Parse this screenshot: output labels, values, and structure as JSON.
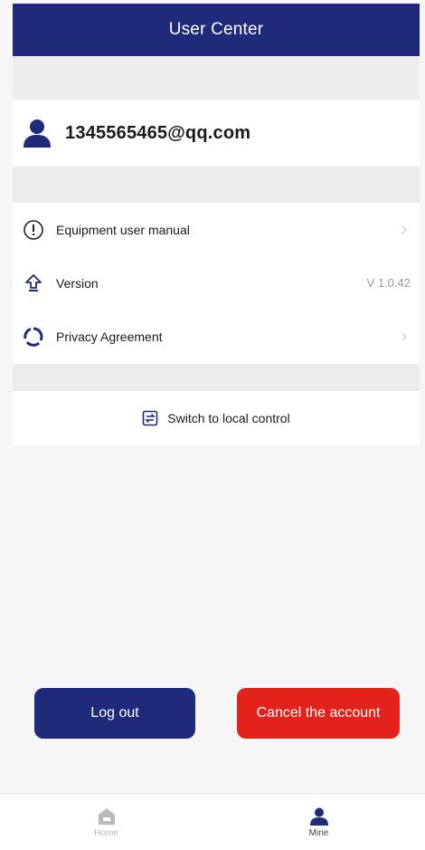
{
  "header": {
    "title": "User Center"
  },
  "user": {
    "email": "1345565465@qq.com",
    "avatar_icon": "user-icon"
  },
  "menu": {
    "items": [
      {
        "label": "Equipment user manual",
        "icon": "info-circle-icon",
        "right": ""
      },
      {
        "label": "Version",
        "icon": "upload-arrow-icon",
        "right": "V 1.0.42"
      },
      {
        "label": "Privacy Agreement",
        "icon": "privacy-cycle-icon",
        "right": ""
      }
    ]
  },
  "switch": {
    "label": "Switch to local control",
    "icon": "switch-icon"
  },
  "buttons": {
    "logout": "Log out",
    "cancel": "Cancel the account"
  },
  "tabbar": {
    "tabs": [
      {
        "label": "Home",
        "icon": "home-icon",
        "active": false
      },
      {
        "label": "Mine",
        "icon": "user-icon",
        "active": true
      }
    ]
  },
  "colors": {
    "primary": "#1f2a7a",
    "danger": "#e3221c",
    "background": "#f6f6f7"
  }
}
